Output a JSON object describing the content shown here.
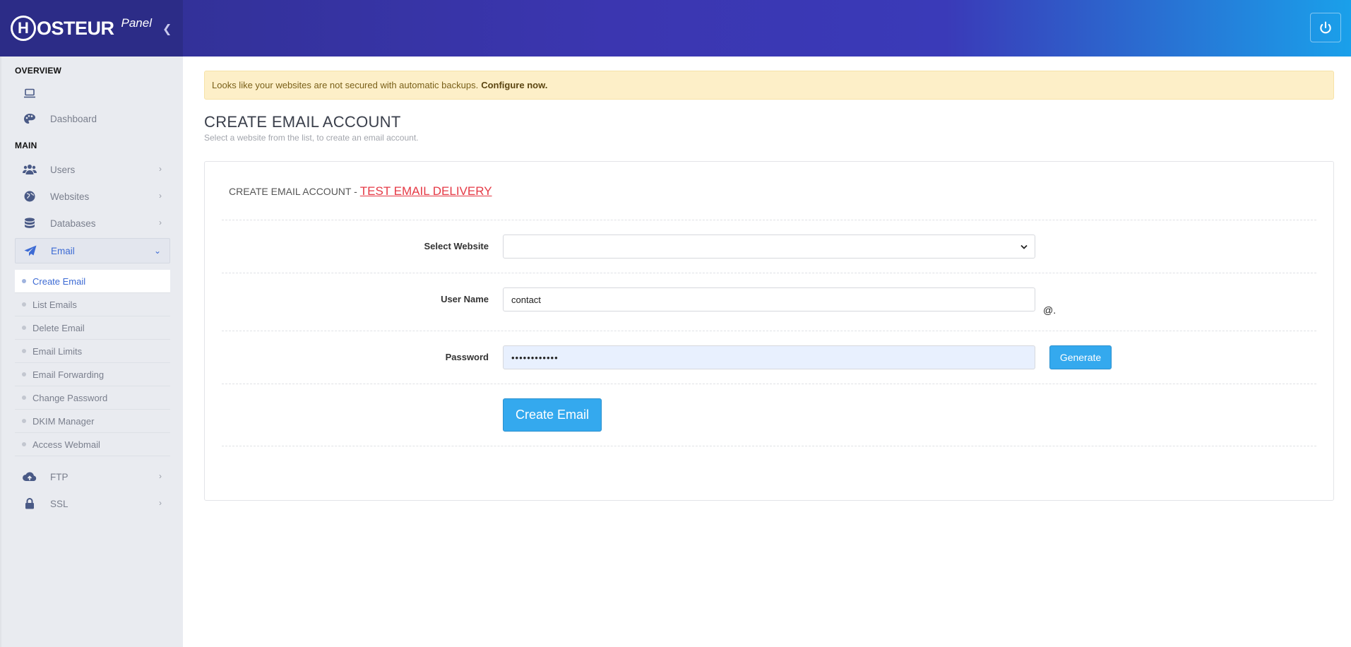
{
  "brand": {
    "logo_letter": "H",
    "logo_text": "OSTEUR",
    "panel_label": "Panel"
  },
  "header": {
    "collapse_icon": "chevron-left-icon",
    "power_icon": "power-icon"
  },
  "sidebar": {
    "overview_title": "OVERVIEW",
    "main_title": "MAIN",
    "overview_items": [
      {
        "label": "",
        "icon": "laptop-icon"
      },
      {
        "label": "Dashboard",
        "icon": "palette-icon"
      }
    ],
    "main_items": [
      {
        "label": "Users",
        "icon": "users-icon"
      },
      {
        "label": "Websites",
        "icon": "globe-icon"
      },
      {
        "label": "Databases",
        "icon": "database-icon"
      },
      {
        "label": "Email",
        "icon": "paper-plane-icon"
      },
      {
        "label": "FTP",
        "icon": "cloud-upload-icon"
      },
      {
        "label": "SSL",
        "icon": "lock-icon"
      }
    ],
    "email_subitems": [
      {
        "label": "Create Email"
      },
      {
        "label": "List Emails"
      },
      {
        "label": "Delete Email"
      },
      {
        "label": "Email Limits"
      },
      {
        "label": "Email Forwarding"
      },
      {
        "label": "Change Password"
      },
      {
        "label": "DKIM Manager"
      },
      {
        "label": "Access Webmail"
      }
    ]
  },
  "alert": {
    "message": "Looks like your websites are not secured with automatic backups.",
    "action": "Configure now."
  },
  "page": {
    "title": "CREATE EMAIL ACCOUNT",
    "subtitle": "Select a website from the list, to create an email account."
  },
  "form": {
    "header_prefix": "CREATE EMAIL ACCOUNT -",
    "header_link": "TEST EMAIL DELIVERY",
    "select_website_label": "Select Website",
    "select_website_value": "",
    "username_label": "User Name",
    "username_value": "contact",
    "at_suffix": "@.",
    "password_label": "Password",
    "password_value": "••••••••••••",
    "generate_label": "Generate",
    "submit_label": "Create Email"
  },
  "colors": {
    "accent": "#34a9ee",
    "link_red": "#e53945",
    "active_blue": "#3d6bd4",
    "alert_bg": "#fdefc8"
  }
}
